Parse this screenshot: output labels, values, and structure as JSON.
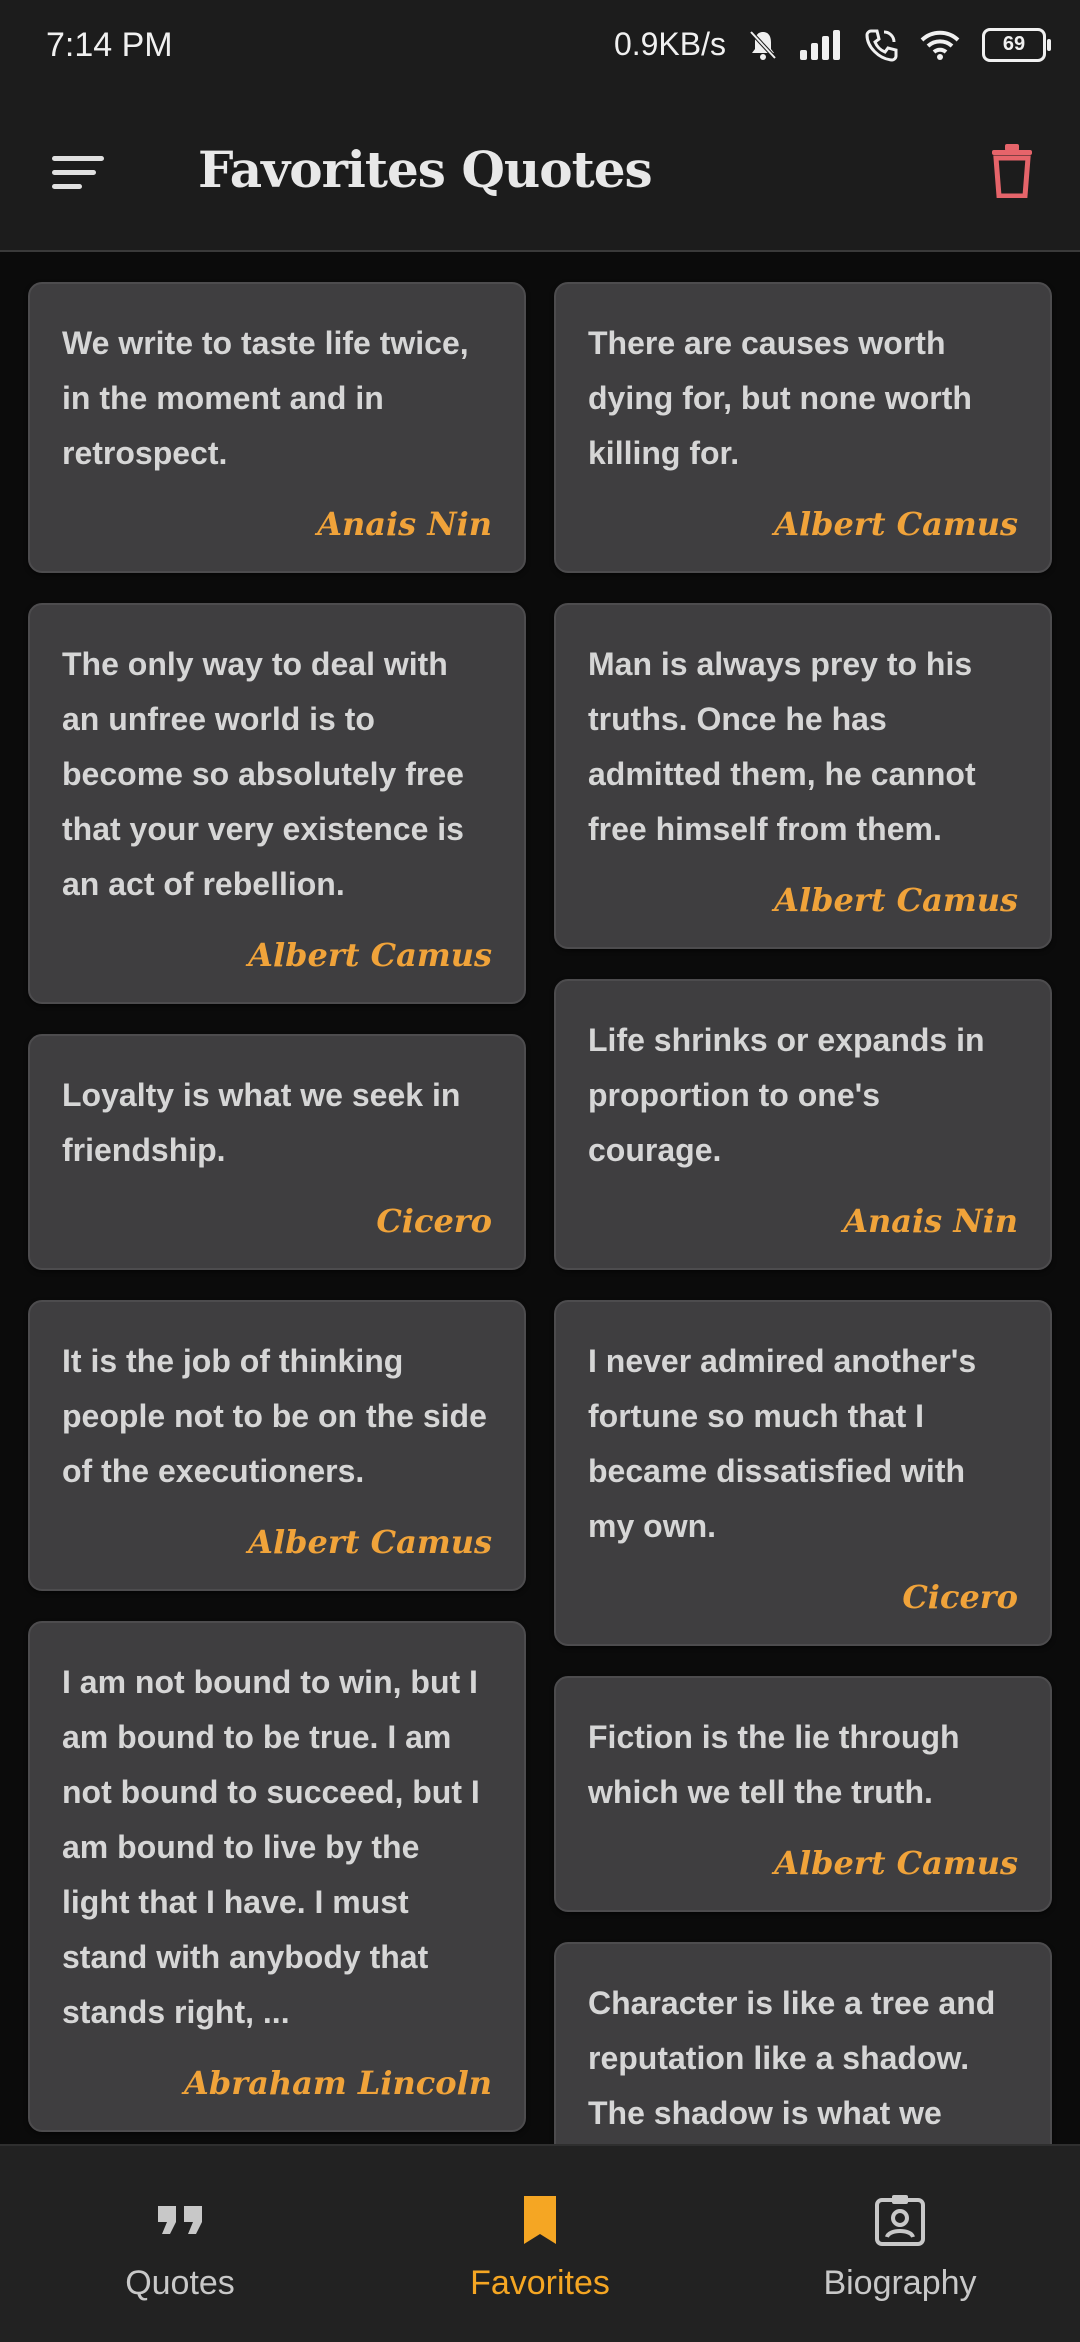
{
  "status_bar": {
    "time": "7:14 PM",
    "speed": "0.9KB/s",
    "battery": "69"
  },
  "app_bar": {
    "title": "Favorites Quotes"
  },
  "cards_left": [
    {
      "quote": "We write to taste life twice, in the moment and in retrospect.",
      "author": "Anais Nin"
    },
    {
      "quote": "The only way to deal with an unfree world is to become so absolutely free that your very existence is an act of rebellion.",
      "author": "Albert Camus"
    },
    {
      "quote": "Loyalty is what we seek in friendship.",
      "author": "Cicero"
    },
    {
      "quote": "It is the job of thinking people not to be on the side of the executioners.",
      "author": "Albert Camus"
    },
    {
      "quote": "I am not bound to win, but I am bound to be true. I am not bound to succeed, but I am bound to live by the light that I have. I must stand with anybody that stands right, ...",
      "author": "Abraham Lincoln"
    }
  ],
  "cards_right": [
    {
      "quote": "There are causes worth dying for, but none worth killing for.",
      "author": "Albert Camus"
    },
    {
      "quote": "Man is always prey to his truths. Once he has admitted them, he cannot free himself from them.",
      "author": "Albert Camus"
    },
    {
      "quote": "Life shrinks or expands in proportion to one's courage.",
      "author": "Anais Nin"
    },
    {
      "quote": "I never admired another's fortune so much that I became dissatisfied with my own.",
      "author": "Cicero"
    },
    {
      "quote": "Fiction is the lie through which we tell the truth.",
      "author": "Albert Camus"
    },
    {
      "quote": "Character is like a tree and reputation like a shadow. The shadow is what we think of it; the tree is the real thing.",
      "author": ""
    }
  ],
  "bottom_nav": {
    "items": [
      {
        "label": "Quotes",
        "icon": "quote-icon",
        "active": false
      },
      {
        "label": "Favorites",
        "icon": "bookmark-icon",
        "active": true
      },
      {
        "label": "Biography",
        "icon": "badge-icon",
        "active": false
      }
    ],
    "active_color": "#f5a623"
  },
  "colors": {
    "accent": "#f0a33a",
    "delete_icon": "#e5646a",
    "card_bg": "#3f3e40",
    "page_bg": "#0b0b0b"
  }
}
